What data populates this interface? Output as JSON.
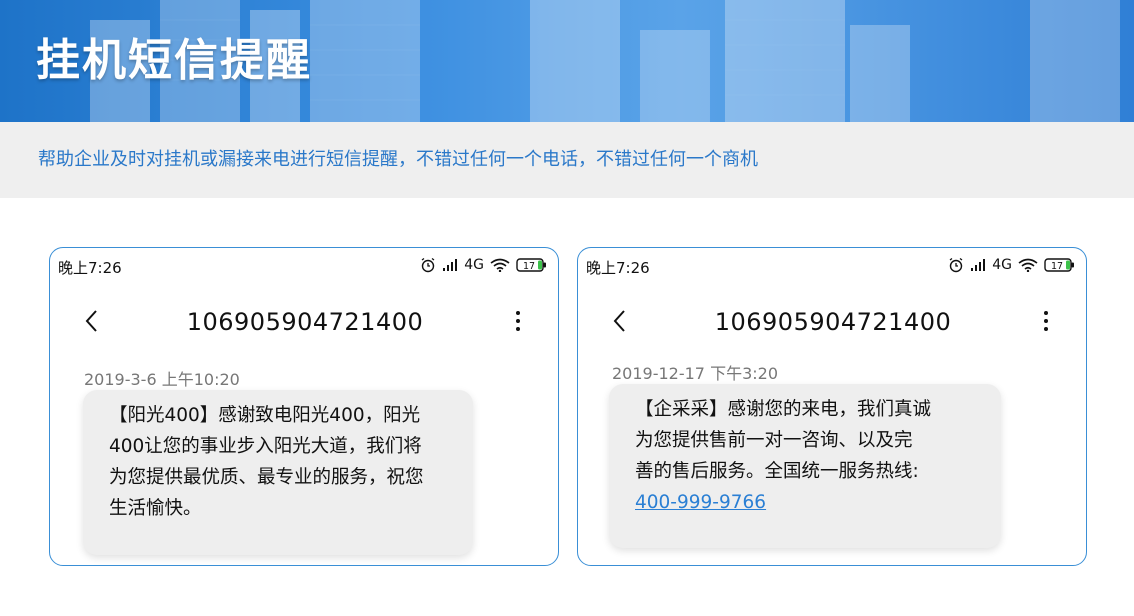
{
  "header": {
    "title": "挂机短信提醒"
  },
  "subtitle": "帮助企业及时对挂机或漏接来电进行短信提醒，不错过任何一个电话，不错过任何一个商机",
  "colors": {
    "banner_blue": "#2f7fd6",
    "subtitle_blue": "#2a78c9",
    "card_border": "#3a8fd6",
    "link_blue": "#2a7fd4"
  },
  "phones": [
    {
      "status_time": "晚上7:26",
      "network": "4G",
      "battery": "17",
      "icons": [
        "alarm-icon",
        "signal-icon",
        "wifi-icon",
        "battery-icon"
      ],
      "sender_number": "106905904721400",
      "message_time": "2019-3-6 上午10:20",
      "message_lines": [
        "【阳光400】感谢致电阳光400，阳光",
        "400让您的事业步入阳光大道，我们将",
        "为您提供最优质、最专业的服务，祝您",
        "生活愉快。"
      ]
    },
    {
      "status_time": "晚上7:26",
      "network": "4G",
      "battery": "17",
      "icons": [
        "alarm-icon",
        "signal-icon",
        "wifi-icon",
        "battery-icon"
      ],
      "sender_number": "106905904721400",
      "message_time": "2019-12-17 下午3:20",
      "message_lines": [
        "【企采采】感谢您的来电，我们真诚",
        "为您提供售前一对一咨询、以及完",
        "善的售后服务。全国统一服务热线:"
      ],
      "hotline": "400-999-9766"
    }
  ]
}
